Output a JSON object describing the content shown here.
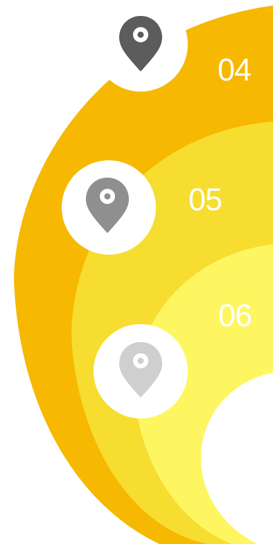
{
  "colors": {
    "background": "#ffffff",
    "ring_outer": "#f6b800",
    "ring_middle": "#f7dd2f",
    "ring_inner": "#fef661",
    "center": "#ffffff",
    "label_text": "#ffffff",
    "badge_bg": "#ffffff"
  },
  "steps": [
    {
      "number": "04",
      "icon": "map-pin-icon",
      "icon_color": "#5c5c5c",
      "ring_color": "#f6b800"
    },
    {
      "number": "05",
      "icon": "map-pin-icon",
      "icon_color": "#8f8f8f",
      "ring_color": "#f7dd2f"
    },
    {
      "number": "06",
      "icon": "map-pin-icon",
      "icon_color": "#cfcfcf",
      "ring_color": "#fef661"
    }
  ]
}
